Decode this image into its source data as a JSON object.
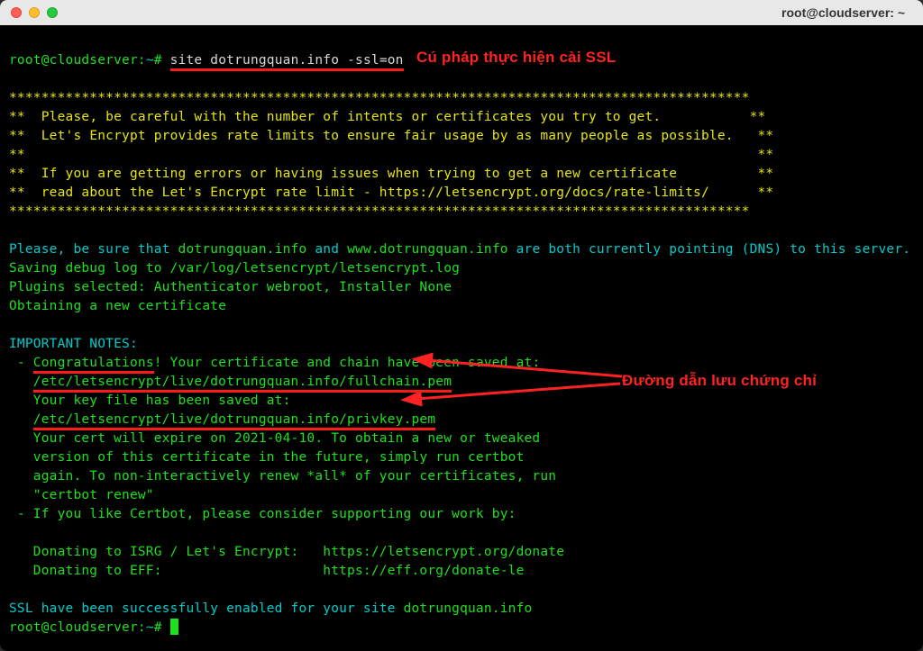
{
  "window": {
    "title": "root@cloudserver: ~"
  },
  "prompt": {
    "user_host": "root@cloudserver",
    "cwd": "~",
    "marker": "#"
  },
  "command": "site dotrungquan.info -ssl=on",
  "asterisk_row": "********************************************************************************************",
  "yellow_box": {
    "line1_mid": "  Please, be careful with the number of intents or certificates you try to get.           ",
    "line2_mid": "  Let's Encrypt provides rate limits to ensure fair usage by as many people as possible.   ",
    "line_blank": "                                                                                           ",
    "line3_mid": "  If you are getting errors or having issues when trying to get a new certificate          ",
    "line4_mid": "  read about the Let's Encrypt rate limit - https://letsencrypt.org/docs/rate-limits/      "
  },
  "dns_line": {
    "prefix": "Please, be sure that ",
    "domain1": "dotrungquan.info",
    "middle": " and ",
    "domain2": "www.dotrungquan.info",
    "suffix": " are both currently pointing (DNS) to this server."
  },
  "info_lines": {
    "saving_log": "Saving debug log to /var/log/letsencrypt/letsencrypt.log",
    "plugins": "Plugins selected: Authenticator webroot, Installer None",
    "obtaining": "Obtaining a new certificate"
  },
  "important_notes_label": "IMPORTANT NOTES:",
  "notes": {
    "congrat_line_prefix": " - ",
    "congrat_word": "Congratulations",
    "congrat_rest": "! Your certificate and chain have been saved at:",
    "path_indent": "   ",
    "fullchain_path": "/etc/letsencrypt/live/dotrungquan.info/fullchain.pem",
    "key_saved": "   Your key file has been saved at:",
    "privkey_path": "/etc/letsencrypt/live/dotrungquan.info/privkey.pem",
    "expire1": "   Your cert will expire on 2021-04-10. To obtain a new or tweaked",
    "expire2": "   version of this certificate in the future, simply run certbot",
    "expire3": "   again. To non-interactively renew *all* of your certificates, run",
    "expire4": "   \"certbot renew\"",
    "like_line": " - If you like Certbot, please consider supporting our work by:",
    "donate1": "   Donating to ISRG / Let's Encrypt:   https://letsencrypt.org/donate",
    "donate2": "   Donating to EFF:                    https://eff.org/donate-le"
  },
  "ssl_success": {
    "prefix": "SSL have been successfully enabled for your site ",
    "domain": "dotrungquan.info"
  },
  "annotations": {
    "top": "Cú pháp thực hiện cài SSL",
    "right": "Đường dẫn lưu chứng chỉ"
  },
  "colors": {
    "annotation_red": "#ff2222",
    "underline_red": "#ff1a1a",
    "term_green": "#1fe01f",
    "term_yellow": "#e5e510",
    "term_cyan": "#00cccc"
  }
}
